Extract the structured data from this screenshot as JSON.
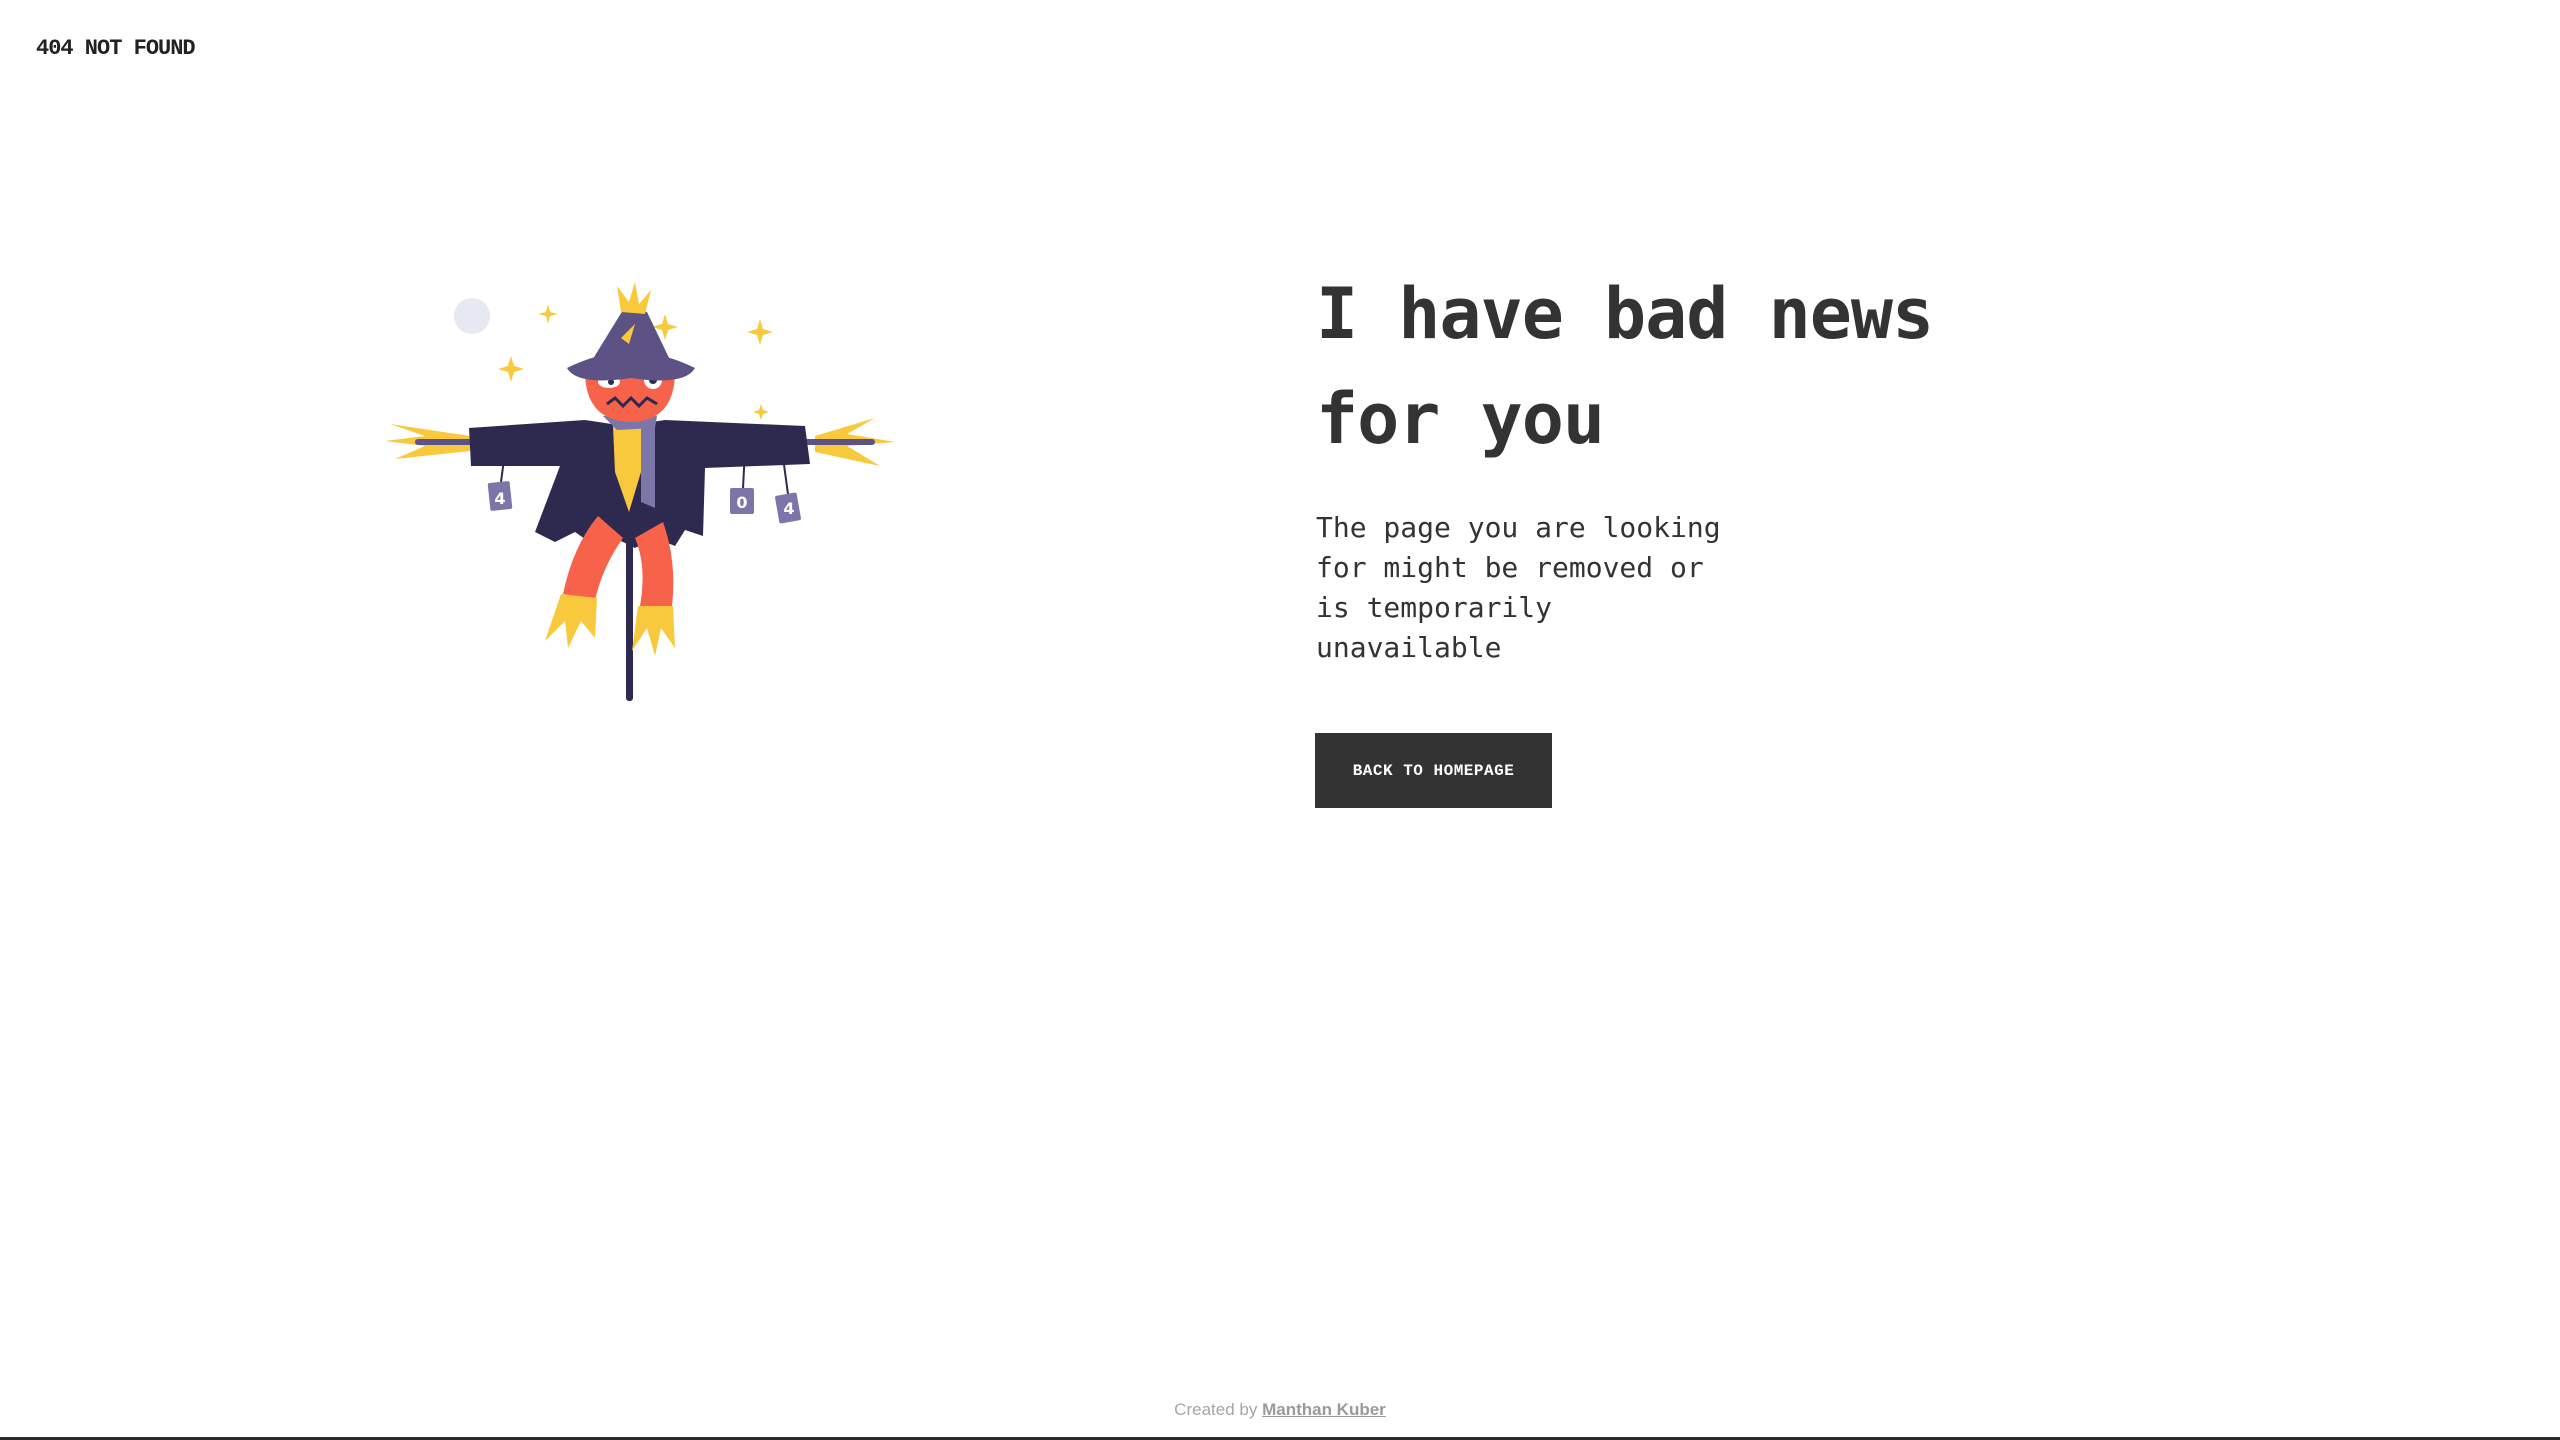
{
  "brand": {
    "title": "404 NOT FOUND"
  },
  "main": {
    "headline_line1": "I have bad news",
    "headline_line2": "for you",
    "message": "The page you are looking\nfor might be removed or\nis temporarily\nunavailable",
    "button_label": "BACK TO HOMEPAGE"
  },
  "illustration": {
    "icon": "scarecrow-icon",
    "tag_labels": [
      "4",
      "0",
      "4"
    ]
  },
  "footer": {
    "prefix": "Created by",
    "author": "Manthan Kuber"
  },
  "colors": {
    "text": "#333333",
    "button_bg": "#333333",
    "button_text": "#ffffff",
    "coat": "#2e2a4f",
    "hat": "#5c5384",
    "face": "#f7624b",
    "straw": "#f8c93c",
    "tags": "#7c76a8",
    "moon": "#e6e8f2",
    "footer_text": "#a6a6a6"
  }
}
